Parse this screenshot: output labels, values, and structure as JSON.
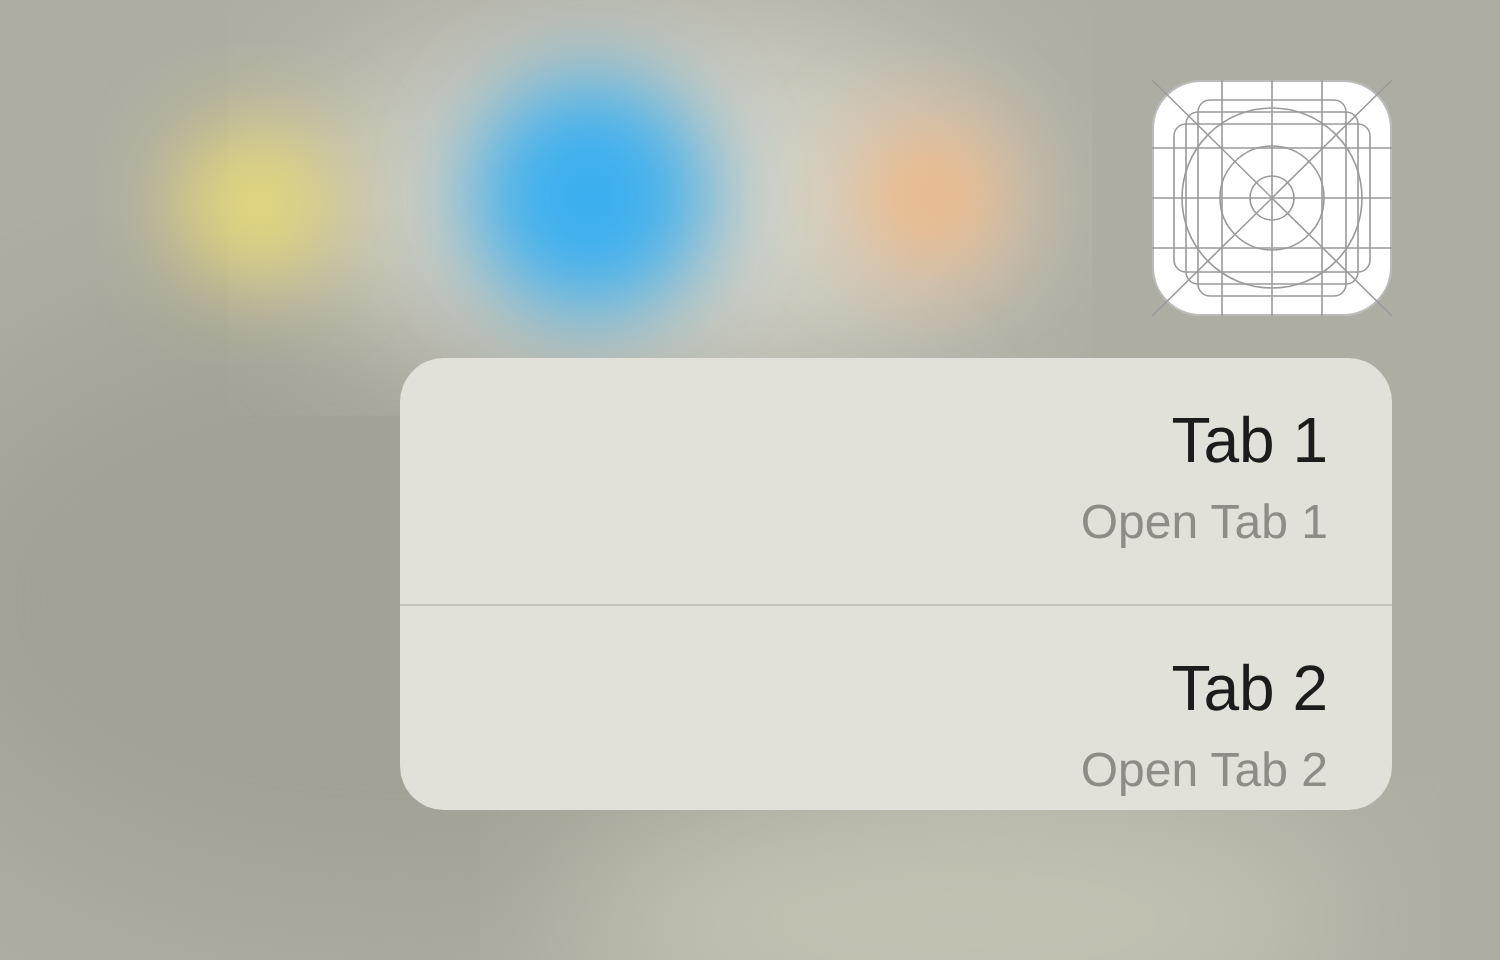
{
  "actions": [
    {
      "title": "Tab 1",
      "subtitle": "Open Tab 1"
    },
    {
      "title": "Tab 2",
      "subtitle": "Open Tab 2"
    }
  ]
}
